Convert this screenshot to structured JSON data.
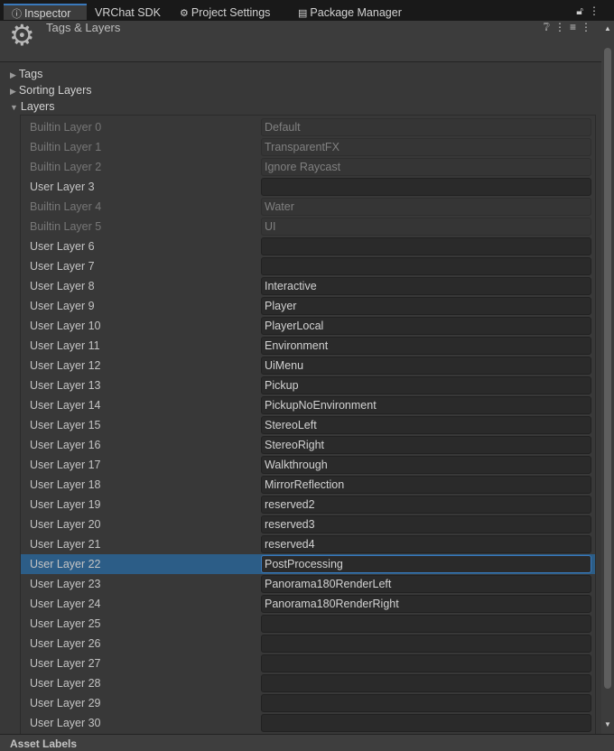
{
  "tabs": [
    {
      "label": "Inspector",
      "icon": "info-icon",
      "active": true
    },
    {
      "label": "VRChat SDK",
      "icon": "",
      "active": false
    },
    {
      "label": "Project Settings",
      "icon": "gear-icon",
      "active": false
    },
    {
      "label": "Package Manager",
      "icon": "package-icon",
      "active": false
    }
  ],
  "header": {
    "title": "Tags & Layers"
  },
  "sections": {
    "tags": "Tags",
    "sorting_layers": "Sorting Layers",
    "layers": "Layers"
  },
  "layers": [
    {
      "label": "Builtin Layer 0",
      "value": "Default",
      "builtin": true
    },
    {
      "label": "Builtin Layer 1",
      "value": "TransparentFX",
      "builtin": true
    },
    {
      "label": "Builtin Layer 2",
      "value": "Ignore Raycast",
      "builtin": true
    },
    {
      "label": "User Layer 3",
      "value": ""
    },
    {
      "label": "Builtin Layer 4",
      "value": "Water",
      "builtin": true
    },
    {
      "label": "Builtin Layer 5",
      "value": "UI",
      "builtin": true
    },
    {
      "label": "User Layer 6",
      "value": ""
    },
    {
      "label": "User Layer 7",
      "value": ""
    },
    {
      "label": "User Layer 8",
      "value": "Interactive"
    },
    {
      "label": "User Layer 9",
      "value": "Player"
    },
    {
      "label": "User Layer 10",
      "value": "PlayerLocal"
    },
    {
      "label": "User Layer 11",
      "value": "Environment"
    },
    {
      "label": "User Layer 12",
      "value": "UiMenu"
    },
    {
      "label": "User Layer 13",
      "value": "Pickup"
    },
    {
      "label": "User Layer 14",
      "value": "PickupNoEnvironment"
    },
    {
      "label": "User Layer 15",
      "value": "StereoLeft"
    },
    {
      "label": "User Layer 16",
      "value": "StereoRight"
    },
    {
      "label": "User Layer 17",
      "value": "Walkthrough"
    },
    {
      "label": "User Layer 18",
      "value": "MirrorReflection"
    },
    {
      "label": "User Layer 19",
      "value": "reserved2"
    },
    {
      "label": "User Layer 20",
      "value": "reserved3"
    },
    {
      "label": "User Layer 21",
      "value": "reserved4"
    },
    {
      "label": "User Layer 22",
      "value": "PostProcessing",
      "selected": true
    },
    {
      "label": "User Layer 23",
      "value": "Panorama180RenderLeft"
    },
    {
      "label": "User Layer 24",
      "value": "Panorama180RenderRight"
    },
    {
      "label": "User Layer 25",
      "value": ""
    },
    {
      "label": "User Layer 26",
      "value": ""
    },
    {
      "label": "User Layer 27",
      "value": ""
    },
    {
      "label": "User Layer 28",
      "value": ""
    },
    {
      "label": "User Layer 29",
      "value": ""
    },
    {
      "label": "User Layer 30",
      "value": ""
    }
  ],
  "footer": {
    "label": "Asset Labels"
  },
  "colors": {
    "accent": "#2c5d87",
    "focus": "#3a79bb"
  }
}
